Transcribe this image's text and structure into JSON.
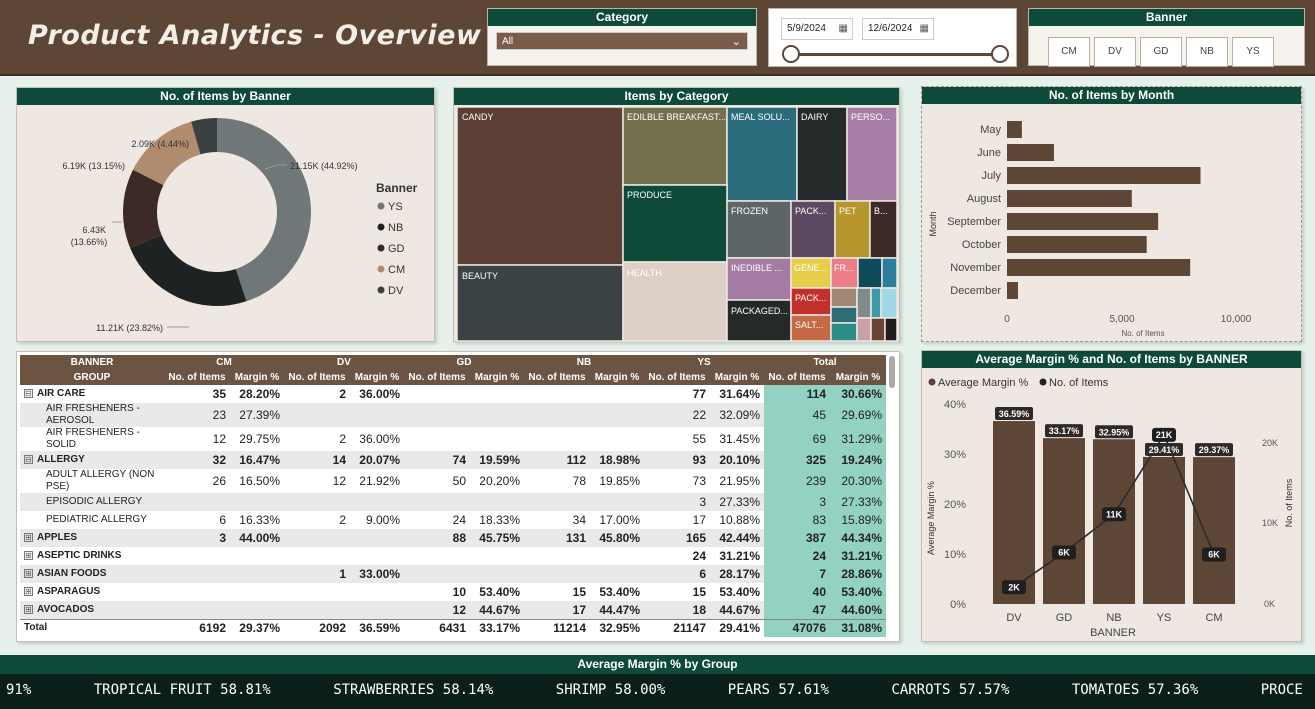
{
  "header": {
    "title": "Product Analytics - Overview"
  },
  "category_slicer": {
    "label": "Category",
    "selected": "All"
  },
  "date_slicer": {
    "start": "5/9/2024",
    "end": "12/6/2024"
  },
  "banner_slicer": {
    "label": "Banner",
    "options": [
      "CM",
      "DV",
      "GD",
      "NB",
      "YS"
    ]
  },
  "donut": {
    "title": "No. of Items by Banner",
    "legend_title": "Banner",
    "legend": [
      "YS",
      "NB",
      "GD",
      "CM",
      "DV"
    ],
    "labels": {
      "ys": "21.15K (44.92%)",
      "nb": "11.21K (23.82%)",
      "gd_a": "6.43K",
      "gd_b": "(13.66%)",
      "cm": "6.19K (13.15%)",
      "dv": "2.09K (4.44%)"
    },
    "colors": {
      "YS": "#6f7778",
      "NB": "#1f2222",
      "GD": "#3d2a26",
      "CM": "#b08b6e",
      "DV": "#3a3f40"
    }
  },
  "treemap": {
    "title": "Items by Category",
    "labels": {
      "candy": "CANDY",
      "breakfast": "EDILBLE BREAKFAST...",
      "meal": "MEAL SOLU...",
      "dairy": "DAIRY",
      "perso": "PERSO...",
      "produce": "PRODUCE",
      "frozen": "FROZEN",
      "pack1": "PACK...",
      "pet": "PET",
      "b": "B...",
      "beauty": "BEAUTY",
      "health": "HEALTH",
      "inedible": "INEDIBLE ...",
      "gene": "GENE...",
      "fr": "FR...",
      "pack2": "PACK...",
      "packaged": "PACKAGED...",
      "salt": "SALT..."
    }
  },
  "month_chart": {
    "title": "No. of Items by Month",
    "ylabel": "Month",
    "xlabel": "No. of Items",
    "ticks": [
      "0",
      "5,000",
      "10,000"
    ]
  },
  "combo": {
    "title": "Average Margin % and No. of Items by BANNER",
    "legend": [
      "Average Margin %",
      "No. of Items"
    ],
    "ylabel_left": "Average Margin %",
    "ylabel_right": "No. of Items",
    "xlabel": "BANNER",
    "left_ticks": [
      "40%",
      "30%",
      "20%",
      "10%",
      "0%"
    ],
    "right_ticks": [
      "20K",
      "10K",
      "0K"
    ]
  },
  "chart_data": [
    {
      "type": "pie",
      "title": "No. of Items by Banner",
      "categories": [
        "YS",
        "NB",
        "GD",
        "CM",
        "DV"
      ],
      "values": [
        21150,
        11210,
        6430,
        6190,
        2090
      ],
      "percent": [
        44.92,
        23.82,
        13.66,
        13.15,
        4.44
      ]
    },
    {
      "type": "bar",
      "title": "No. of Items by Month",
      "categories": [
        "May",
        "June",
        "July",
        "August",
        "September",
        "October",
        "November",
        "December"
      ],
      "values": [
        650,
        2050,
        8450,
        5450,
        6600,
        6100,
        8000,
        480
      ],
      "xlim": [
        0,
        11000
      ],
      "xlabel": "No. of Items",
      "ylabel": "Month"
    },
    {
      "type": "bar",
      "title": "Average Margin % and No. of Items by BANNER",
      "categories": [
        "DV",
        "GD",
        "NB",
        "YS",
        "CM"
      ],
      "series": [
        {
          "name": "Average Margin %",
          "values": [
            36.59,
            33.17,
            32.95,
            29.41,
            29.37
          ],
          "labels": [
            "36.59%",
            "33.17%",
            "32.95%",
            "29.41%",
            "29.37%"
          ]
        },
        {
          "name": "No. of Items",
          "values": [
            2092,
            6431,
            11214,
            21147,
            6192
          ],
          "labels": [
            "2K",
            "6K",
            "11K",
            "21K",
            "6K"
          ]
        }
      ],
      "ylim": [
        0,
        40
      ],
      "y2lim": [
        0,
        25000
      ]
    }
  ],
  "matrix": {
    "header1": [
      "BANNER",
      "CM",
      "DV",
      "GD",
      "NB",
      "YS",
      "Total"
    ],
    "header2": [
      "GROUP",
      "No. of Items",
      "Margin %",
      "No. of Items",
      "Margin %",
      "No. of Items",
      "Margin %",
      "No. of Items",
      "Margin %",
      "No. of Items",
      "Margin %",
      "No. of Items",
      "Margin %"
    ],
    "rows": [
      {
        "level": 1,
        "exp": "⊟",
        "cells": [
          "AIR CARE",
          "35",
          "28.20%",
          "2",
          "36.00%",
          "",
          "",
          "",
          "",
          "77",
          "31.64%",
          "114",
          "30.66%"
        ]
      },
      {
        "level": 2,
        "exp": "",
        "cells": [
          "AIR FRESHENERS - AEROSOL",
          "23",
          "27.39%",
          "",
          "",
          "",
          "",
          "",
          "",
          "22",
          "32.09%",
          "45",
          "29.69%"
        ]
      },
      {
        "level": 2,
        "exp": "",
        "cells": [
          "AIR FRESHENERS - SOLID",
          "12",
          "29.75%",
          "2",
          "36.00%",
          "",
          "",
          "",
          "",
          "55",
          "31.45%",
          "69",
          "31.29%"
        ]
      },
      {
        "level": 1,
        "exp": "⊟",
        "cells": [
          "ALLERGY",
          "32",
          "16.47%",
          "14",
          "20.07%",
          "74",
          "19.59%",
          "112",
          "18.98%",
          "93",
          "20.10%",
          "325",
          "19.24%"
        ]
      },
      {
        "level": 2,
        "exp": "",
        "cells": [
          "ADULT ALLERGY (NON PSE)",
          "26",
          "16.50%",
          "12",
          "21.92%",
          "50",
          "20.20%",
          "78",
          "19.85%",
          "73",
          "21.95%",
          "239",
          "20.30%"
        ]
      },
      {
        "level": 2,
        "exp": "",
        "cells": [
          "EPISODIC ALLERGY",
          "",
          "",
          "",
          "",
          "",
          "",
          "",
          "",
          "3",
          "27.33%",
          "3",
          "27.33%"
        ]
      },
      {
        "level": 2,
        "exp": "",
        "cells": [
          "PEDIATRIC ALLERGY",
          "6",
          "16.33%",
          "2",
          "9.00%",
          "24",
          "18.33%",
          "34",
          "17.00%",
          "17",
          "10.88%",
          "83",
          "15.89%"
        ]
      },
      {
        "level": 1,
        "exp": "⊞",
        "cells": [
          "APPLES",
          "3",
          "44.00%",
          "",
          "",
          "88",
          "45.75%",
          "131",
          "45.80%",
          "165",
          "42.44%",
          "387",
          "44.34%"
        ]
      },
      {
        "level": 1,
        "exp": "⊞",
        "cells": [
          "ASEPTIC DRINKS",
          "",
          "",
          "",
          "",
          "",
          "",
          "",
          "",
          "24",
          "31.21%",
          "24",
          "31.21%"
        ]
      },
      {
        "level": 1,
        "exp": "⊞",
        "cells": [
          "ASIAN FOODS",
          "",
          "",
          "1",
          "33.00%",
          "",
          "",
          "",
          "",
          "6",
          "28.17%",
          "7",
          "28.86%"
        ]
      },
      {
        "level": 1,
        "exp": "⊞",
        "cells": [
          "ASPARAGUS",
          "",
          "",
          "",
          "",
          "10",
          "53.40%",
          "15",
          "53.40%",
          "15",
          "53.40%",
          "40",
          "53.40%"
        ]
      },
      {
        "level": 1,
        "exp": "⊞",
        "cells": [
          "AVOCADOS",
          "",
          "",
          "",
          "",
          "12",
          "44.67%",
          "17",
          "44.47%",
          "18",
          "44.67%",
          "47",
          "44.60%"
        ]
      }
    ],
    "total": [
      "Total",
      "6192",
      "29.37%",
      "2092",
      "36.59%",
      "6431",
      "33.17%",
      "11214",
      "32.95%",
      "21147",
      "29.41%",
      "47076",
      "31.08%"
    ]
  },
  "ticker": {
    "title": "Average Margin % by Group",
    "items": [
      "91%",
      "TROPICAL FRUIT 58.81%",
      "STRAWBERRIES 58.14%",
      "SHRIMP 58.00%",
      "PEARS 57.61%",
      "CARROTS 57.57%",
      "TOMATOES 57.36%",
      "PROCE"
    ]
  }
}
